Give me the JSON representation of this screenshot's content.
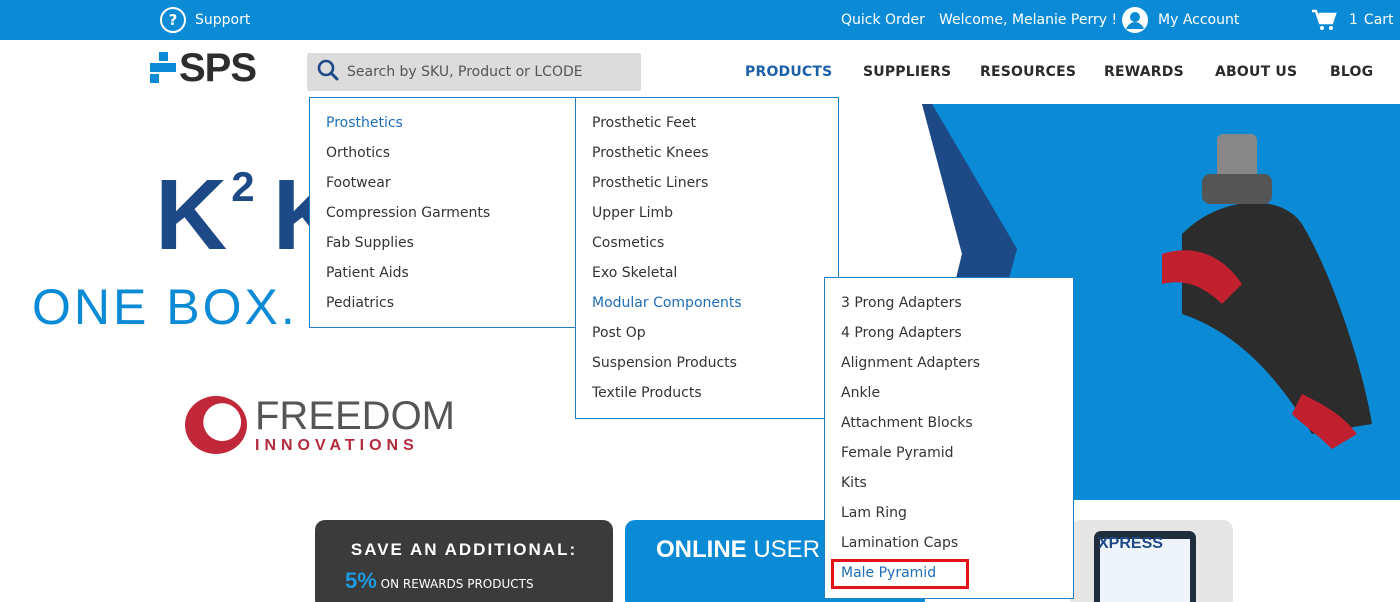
{
  "topbar": {
    "support_label": "Support",
    "quick_order_label": "Quick Order",
    "welcome_text": "Welcome, Melanie Perry !",
    "my_account_label": "My Account",
    "cart_count": "1",
    "cart_label": "Cart"
  },
  "header": {
    "logo_text": "SPS",
    "search_placeholder": "Search by SKU, Product or LCODE",
    "nav": [
      {
        "label": "PRODUCTS"
      },
      {
        "label": "SUPPLIERS"
      },
      {
        "label": "RESOURCES"
      },
      {
        "label": "REWARDS"
      },
      {
        "label": "ABOUT US"
      },
      {
        "label": "BLOG"
      }
    ]
  },
  "hero": {
    "k2_text": "K",
    "k2_sup": "2",
    "k2_tail": "K",
    "one_box_text": "ONE BOX.",
    "brand_name": "FREEDOM",
    "brand_sub": "INNOVATIONS"
  },
  "promos": {
    "card1_title": "SAVE AN ADDITIONAL:",
    "card1_percent": "5%",
    "card1_sub": "ON REWARDS PRODUCTS",
    "card2_bold": "ONLINE",
    "card2_rest": "USER G",
    "card3_logo": "XPRESS"
  },
  "menu_level1": [
    {
      "label": "Prosthetics"
    },
    {
      "label": "Orthotics"
    },
    {
      "label": "Footwear"
    },
    {
      "label": "Compression Garments"
    },
    {
      "label": "Fab Supplies"
    },
    {
      "label": "Patient Aids"
    },
    {
      "label": "Pediatrics"
    }
  ],
  "menu_level2": [
    {
      "label": "Prosthetic Feet"
    },
    {
      "label": "Prosthetic Knees"
    },
    {
      "label": "Prosthetic Liners"
    },
    {
      "label": "Upper Limb"
    },
    {
      "label": "Cosmetics"
    },
    {
      "label": "Exo Skeletal"
    },
    {
      "label": "Modular Components"
    },
    {
      "label": "Post Op"
    },
    {
      "label": "Suspension Products"
    },
    {
      "label": "Textile Products"
    }
  ],
  "menu_level3": [
    {
      "label": "3 Prong Adapters"
    },
    {
      "label": "4 Prong Adapters"
    },
    {
      "label": "Alignment Adapters"
    },
    {
      "label": "Ankle"
    },
    {
      "label": "Attachment Blocks"
    },
    {
      "label": "Female Pyramid"
    },
    {
      "label": "Kits"
    },
    {
      "label": "Lam Ring"
    },
    {
      "label": "Lamination Caps"
    },
    {
      "label": "Male Pyramid"
    }
  ],
  "colors": {
    "brand_blue": "#0b8bd6",
    "navy": "#1d4987",
    "active_link": "#1d6db8",
    "highlight_red": "#e3131b"
  }
}
